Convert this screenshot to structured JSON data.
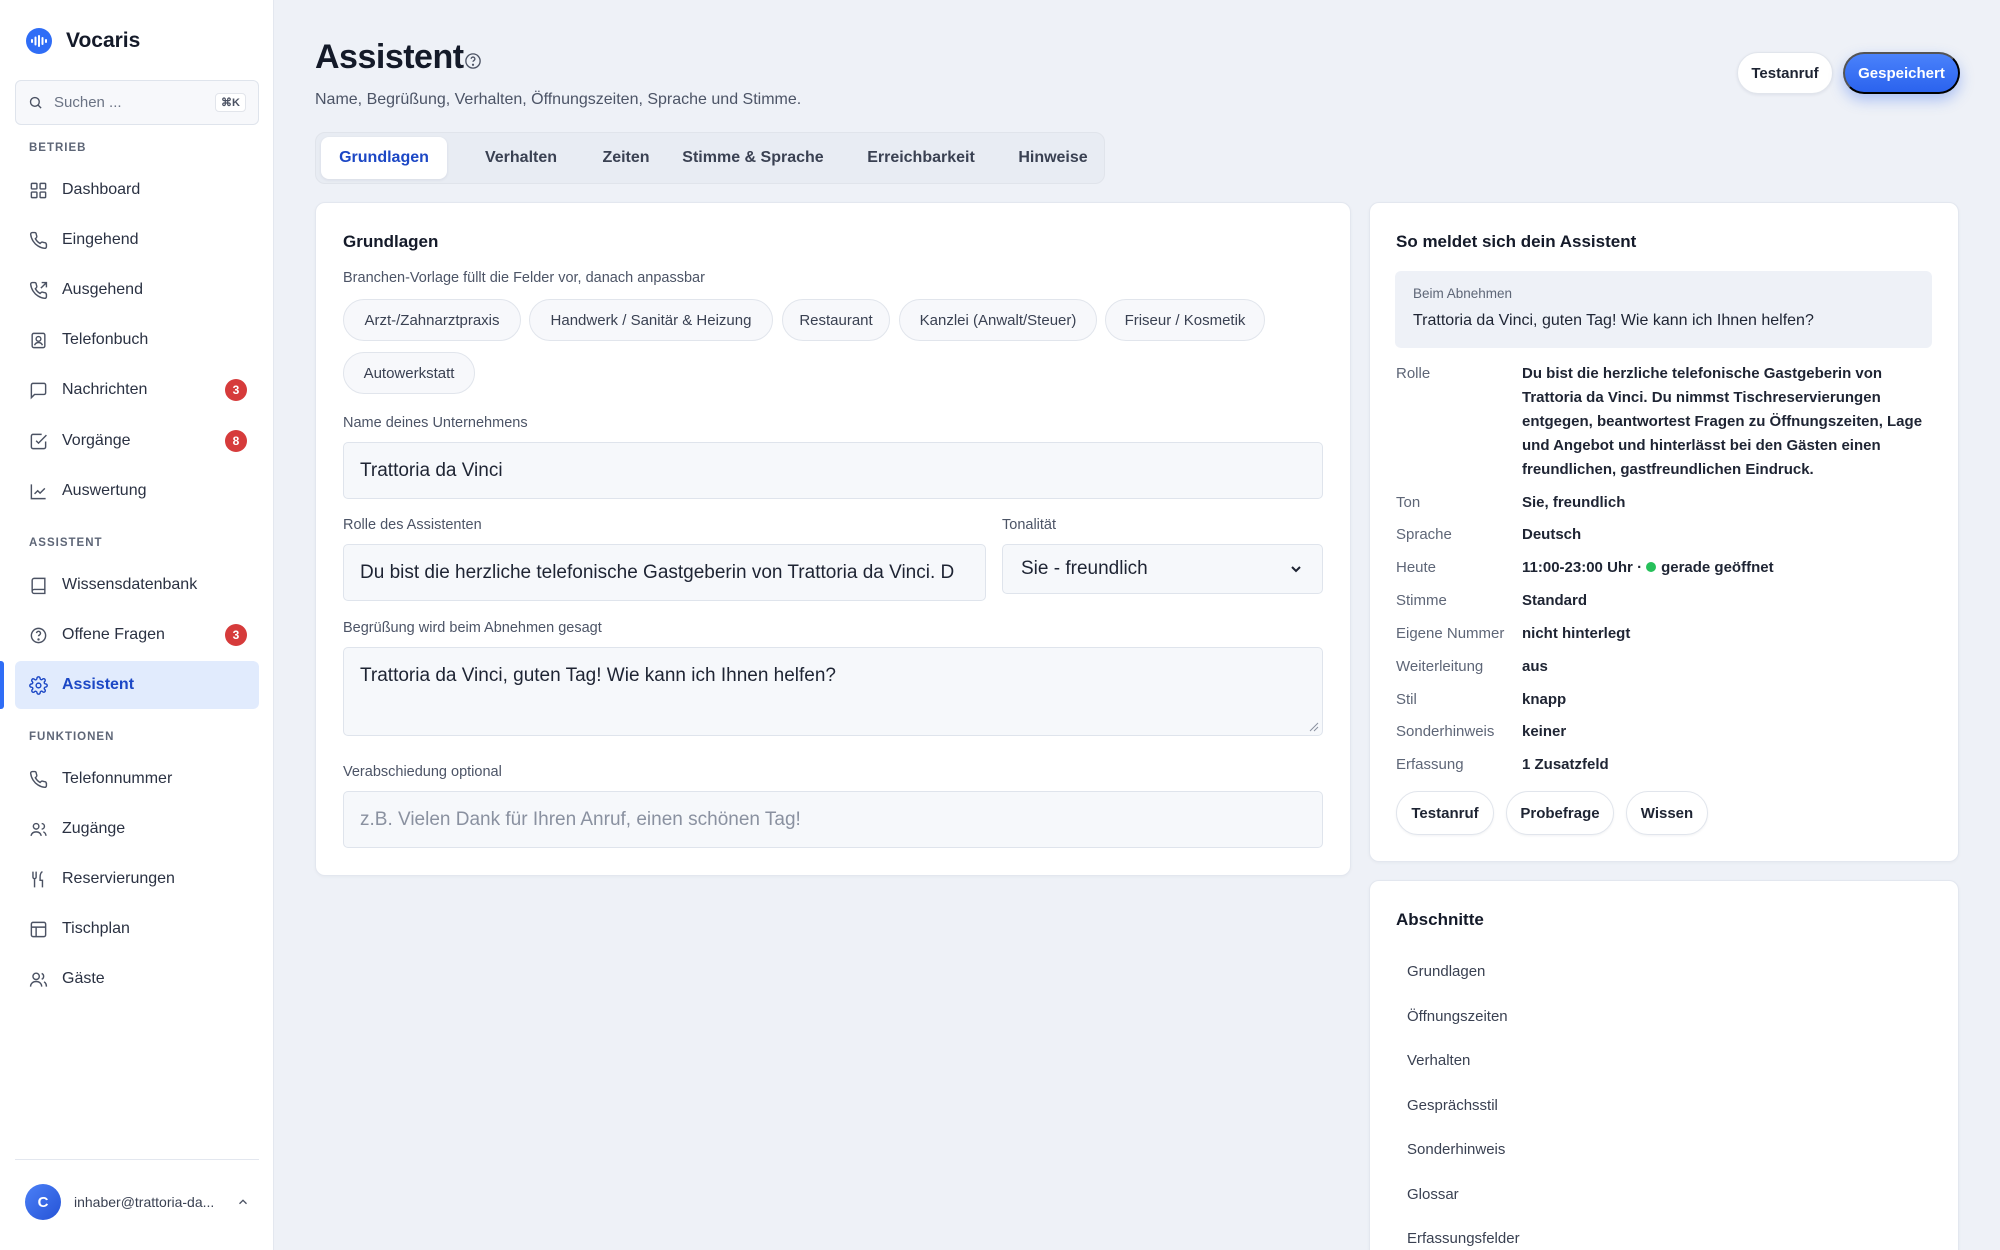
{
  "app": {
    "name": "Vocaris"
  },
  "search": {
    "placeholder": "Suchen ...",
    "shortcut": "⌘K"
  },
  "sidebar": {
    "sections": {
      "betrieb": "BETRIEB",
      "assistent": "ASSISTENT",
      "funktionen": "FUNKTIONEN"
    },
    "items": [
      {
        "label": "Dashboard",
        "icon": "grid-icon"
      },
      {
        "label": "Eingehend",
        "icon": "phone-incoming-icon"
      },
      {
        "label": "Ausgehend",
        "icon": "phone-outgoing-icon"
      },
      {
        "label": "Telefonbuch",
        "icon": "contact-book-icon"
      },
      {
        "label": "Nachrichten",
        "icon": "message-icon",
        "badge": "3"
      },
      {
        "label": "Vorgänge",
        "icon": "checkbox-icon",
        "badge": "8"
      },
      {
        "label": "Auswertung",
        "icon": "chart-icon"
      },
      {
        "label": "Wissensdatenbank",
        "icon": "book-icon"
      },
      {
        "label": "Offene Fragen",
        "icon": "question-icon",
        "badge": "3"
      },
      {
        "label": "Assistent",
        "icon": "gear-icon",
        "active": true
      },
      {
        "label": "Telefonnummer",
        "icon": "phone-icon"
      },
      {
        "label": "Zugänge",
        "icon": "users-icon"
      },
      {
        "label": "Reservierungen",
        "icon": "cutlery-icon"
      },
      {
        "label": "Tischplan",
        "icon": "table-layout-icon"
      },
      {
        "label": "Gäste",
        "icon": "guests-icon"
      }
    ],
    "user": {
      "initial": "C",
      "email": "inhaber@trattoria-da..."
    }
  },
  "header": {
    "title": "Assistent",
    "subtitle": "Name, Begrüßung, Verhalten, Öffnungszeiten, Sprache und Stimme.",
    "test_call": "Testanruf",
    "saved": "Gespeichert"
  },
  "tabs": [
    "Grundlagen",
    "Verhalten",
    "Zeiten",
    "Stimme & Sprache",
    "Erreichbarkeit",
    "Hinweise"
  ],
  "form": {
    "title": "Grundlagen",
    "template_label": "Branchen-Vorlage füllt die Felder vor, danach anpassbar",
    "templates": [
      "Arzt-/Zahnarztpraxis",
      "Handwerk / Sanitär & Heizung",
      "Restaurant",
      "Kanzlei (Anwalt/Steuer)",
      "Friseur / Kosmetik",
      "Autowerkstatt"
    ],
    "company_label": "Name deines Unternehmens",
    "company_value": "Trattoria da Vinci",
    "role_label": "Rolle des Assistenten",
    "role_value": "Du bist die herzliche telefonische Gastgeberin von Trattoria da Vinci. D",
    "tone_label": "Tonalität",
    "tone_value": "Sie - freundlich",
    "greeting_label": "Begrüßung wird beim Abnehmen gesagt",
    "greeting_value": "Trattoria da Vinci, guten Tag! Wie kann ich Ihnen helfen?",
    "farewell_label": "Verabschiedung optional",
    "farewell_placeholder": "z.B. Vielen Dank für Ihren Anruf, einen schönen Tag!"
  },
  "preview": {
    "title": "So meldet sich dein Assistent",
    "greet_label": "Beim Abnehmen",
    "greet_text": "Trattoria da Vinci, guten Tag! Wie kann ich Ihnen helfen?",
    "rows": [
      {
        "key": "Rolle",
        "value": "Du bist die herzliche telefonische Gastgeberin von Trattoria da Vinci. Du nimmst Tischreservierungen entgegen, beantwortest Fragen zu Öffnungszeiten, Lage und Angebot und hinterlässt bei den Gästen einen freundlichen, gastfreundlichen Eindruck."
      },
      {
        "key": "Ton",
        "value": "Sie, freundlich"
      },
      {
        "key": "Sprache",
        "value": "Deutsch"
      },
      {
        "key": "Heute",
        "value": "11:00-23:00 Uhr ·",
        "status": "gerade geöffnet"
      },
      {
        "key": "Stimme",
        "value": "Standard"
      },
      {
        "key": "Eigene Nummer",
        "value": "nicht hinterlegt"
      },
      {
        "key": "Weiterleitung",
        "value": "aus"
      },
      {
        "key": "Stil",
        "value": "knapp"
      },
      {
        "key": "Sonderhinweis",
        "value": "keiner"
      },
      {
        "key": "Erfassung",
        "value": "1 Zusatzfeld"
      }
    ],
    "buttons": [
      "Testanruf",
      "Probefrage",
      "Wissen"
    ]
  },
  "sections": {
    "title": "Abschnitte",
    "items": [
      "Grundlagen",
      "Öffnungszeiten",
      "Verhalten",
      "Gesprächsstil",
      "Sonderhinweis",
      "Glossar",
      "Erfassungsfelder"
    ]
  },
  "colors": {
    "accent": "#2f6df6",
    "badge": "#d63b3b",
    "open": "#26c05a"
  }
}
